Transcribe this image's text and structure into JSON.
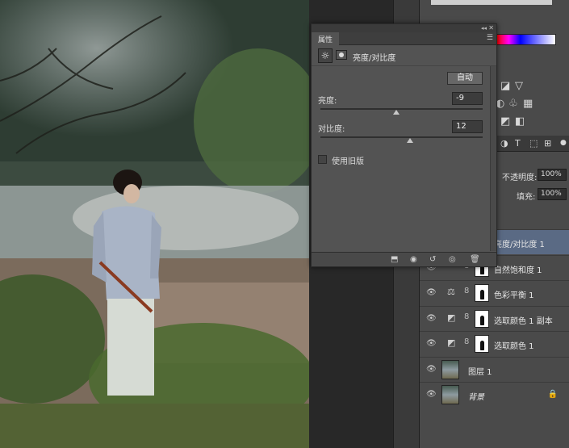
{
  "properties": {
    "tab_label": "属性",
    "adjustment_title": "亮度/对比度",
    "auto_label": "自动",
    "brightness_label": "亮度:",
    "brightness_value": "-9",
    "contrast_label": "对比度:",
    "contrast_value": "12",
    "legacy_label": "使用旧版",
    "brightness_position": 0.47,
    "contrast_position": 0.55
  },
  "layer_options": {
    "opacity_label": "不透明度:",
    "opacity_value": "100%",
    "fill_label": "填充:",
    "fill_value": "100%"
  },
  "layers": [
    {
      "name": "亮度/对比度 1"
    },
    {
      "name": "自然饱和度 1"
    },
    {
      "name": "色彩平衡 1"
    },
    {
      "name": "选取颜色 1 副本"
    },
    {
      "name": "选取颜色 1"
    },
    {
      "name": "图层 1"
    },
    {
      "name": "背景"
    }
  ],
  "icons": {
    "eye": "👁",
    "chain": "8",
    "lock": "🔒"
  }
}
